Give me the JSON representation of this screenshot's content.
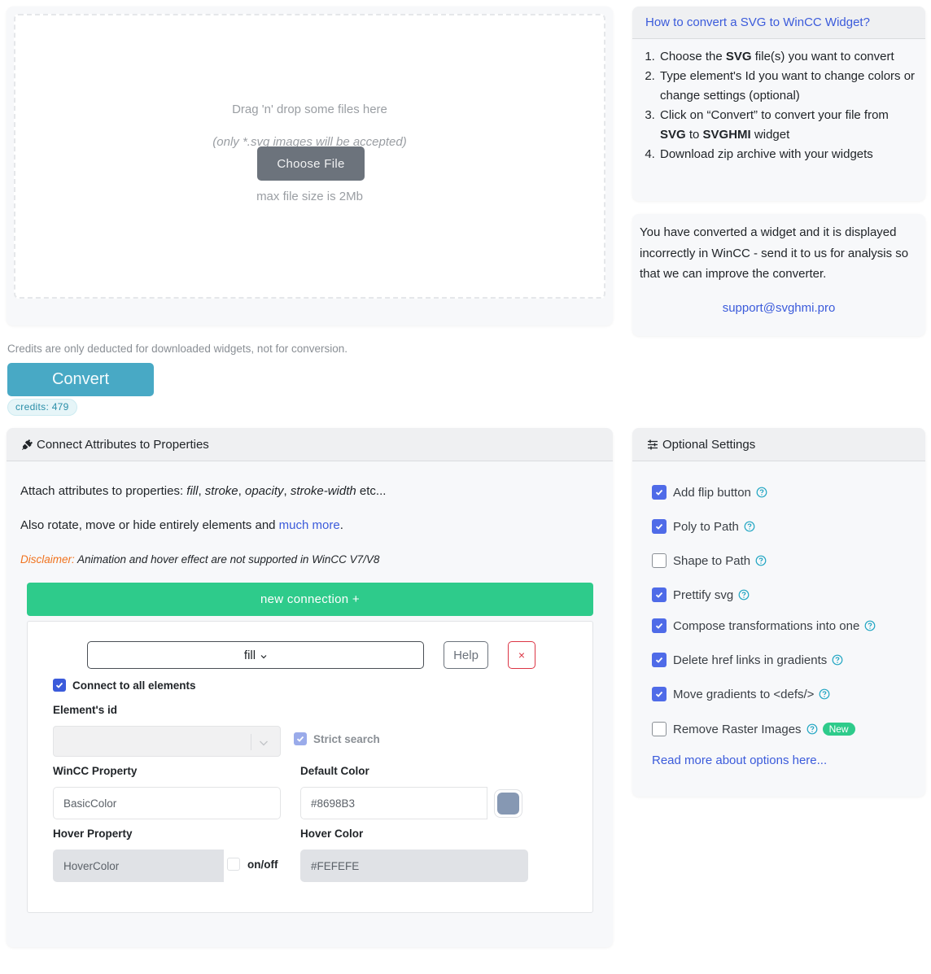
{
  "upload": {
    "drag_text": "Drag 'n' drop some files here",
    "accept_text": "(only *.svg images will be accepted)",
    "choose_label": "Choose File",
    "max_size_text": "max file size is 2Mb"
  },
  "howto": {
    "title": "How to convert a SVG to WinCC Widget?",
    "steps": [
      {
        "pre": "Choose the ",
        "b1": "SVG",
        "mid": " file(s) you want to convert",
        "b2": "",
        "post": ""
      },
      {
        "pre": "Type element's Id you want to change colors or change settings (optional)",
        "b1": "",
        "mid": "",
        "b2": "",
        "post": ""
      },
      {
        "pre": "Click on “Convert” to convert your file from ",
        "b1": "SVG",
        "mid": " to ",
        "b2": "SVGHMI",
        "post": " widget"
      },
      {
        "pre": "Download zip archive with your widgets",
        "b1": "",
        "mid": "",
        "b2": "",
        "post": ""
      }
    ]
  },
  "support": {
    "text": "You have converted a widget and it is displayed incorrectly in WinCC - send it to us for analysis so that we can improve the converter.",
    "email": "support@svghmi.pro"
  },
  "convert": {
    "note": "Credits are only deducted for downloaded widgets, not for conversion.",
    "button_label": "Convert",
    "credits_badge": "credits: 479"
  },
  "connect": {
    "title": "Connect Attributes to Properties",
    "icon": "plug-icon",
    "attach_prefix": "Attach attributes to properties: ",
    "attach_items": [
      "fill",
      "stroke",
      "opacity",
      "stroke-width"
    ],
    "attach_suffix": " etc...",
    "also_text": "Also rotate, move or hide entirely elements and ",
    "also_link": "much more",
    "also_end": ".",
    "disclaimer_label": "Disclaimer:",
    "disclaimer_text": " Animation and hover effect are not supported in WinCC V7/V8",
    "new_connection_label": "new connection +",
    "connection": {
      "attribute": "fill",
      "help_label": "Help",
      "remove_label": "×",
      "connect_all_label": "Connect to all elements",
      "connect_all_checked": true,
      "element_id_label": "Element's id",
      "element_id_value": "",
      "strict_search_label": "Strict search",
      "strict_search_checked": true,
      "wincc_property_label": "WinCC Property",
      "wincc_property_value": "BasicColor",
      "default_color_label": "Default Color",
      "default_color_value": "#8698B3",
      "hover_property_label": "Hover Property",
      "hover_property_value": "HoverColor",
      "hover_onoff_label": "on/off",
      "hover_onoff_checked": false,
      "hover_color_label": "Hover Color",
      "hover_color_value": "#FEFEFE"
    }
  },
  "settings": {
    "title": "Optional Settings",
    "icon": "sliders-icon",
    "options": [
      {
        "label": "Add flip button",
        "checked": true
      },
      {
        "label": "Poly to Path",
        "checked": true
      },
      {
        "label": "Shape to Path",
        "checked": false
      },
      {
        "label": "Prettify svg",
        "checked": true
      },
      {
        "label": "Compose transformations into one",
        "checked": true
      },
      {
        "label": "Delete href links in gradients",
        "checked": true
      },
      {
        "label": "Move gradients to <defs/>",
        "checked": true
      },
      {
        "label": "Remove Raster Images",
        "checked": false,
        "badge": "New"
      }
    ],
    "read_more": "Read more about options here..."
  },
  "colors": {
    "primary": "#3b5bdb",
    "success": "#2ecb8b",
    "info": "#48a9c5",
    "danger": "#dc3545",
    "warning": "#f0731f"
  }
}
